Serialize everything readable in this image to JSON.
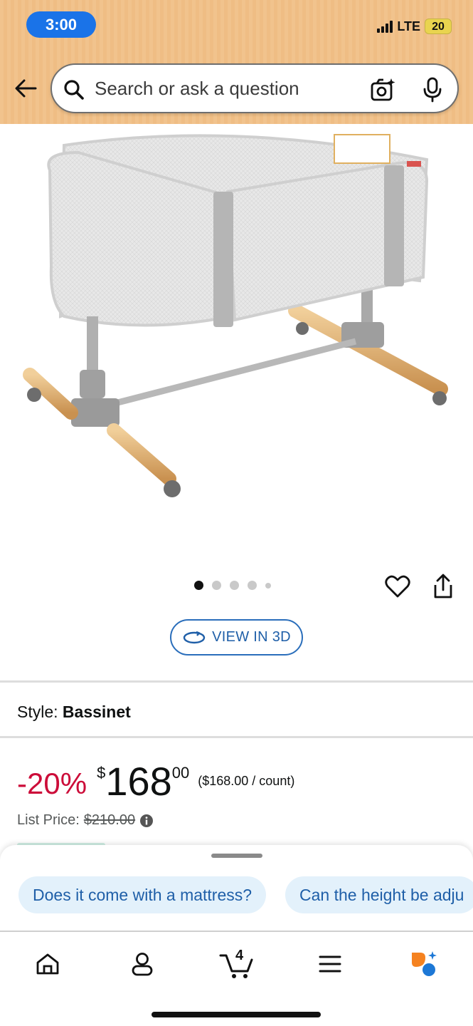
{
  "status_bar": {
    "time": "3:00",
    "network": "LTE",
    "battery": "20"
  },
  "search": {
    "placeholder": "Search or ask a question"
  },
  "icons": {
    "back": "arrow-left-icon",
    "search": "search-icon",
    "camera": "camera-sparkle-icon",
    "mic": "microphone-icon",
    "wishlist": "heart-icon",
    "share": "share-icon",
    "info": "info-icon",
    "rotate3d": "rotate-3d-icon"
  },
  "product": {
    "image_alt": "bassinet-product-image",
    "carousel": {
      "count": 5,
      "active": 0
    },
    "view_3d_label": "VIEW IN 3D",
    "style_label": "Style:",
    "style_value": "Bassinet",
    "discount": "-20%",
    "price_symbol": "$",
    "price_whole": "168",
    "price_fraction": "00",
    "unit_price": "($168.00 / count)",
    "list_price_label": "List Price:",
    "list_price_value": "$210.00"
  },
  "bottom_sheet": {
    "chips": [
      "Does it come with a mattress?",
      "Can the height be adju"
    ]
  },
  "tab_bar": {
    "cart_count": "4",
    "tabs": [
      "home",
      "account",
      "cart",
      "menu",
      "rufus-ai"
    ]
  },
  "colors": {
    "header_bg": "#f1c38d",
    "discount": "#cc0c39",
    "link_blue": "#1f5fa8",
    "chip_bg": "#e3f1fb",
    "time_pill": "#1a73e8"
  }
}
